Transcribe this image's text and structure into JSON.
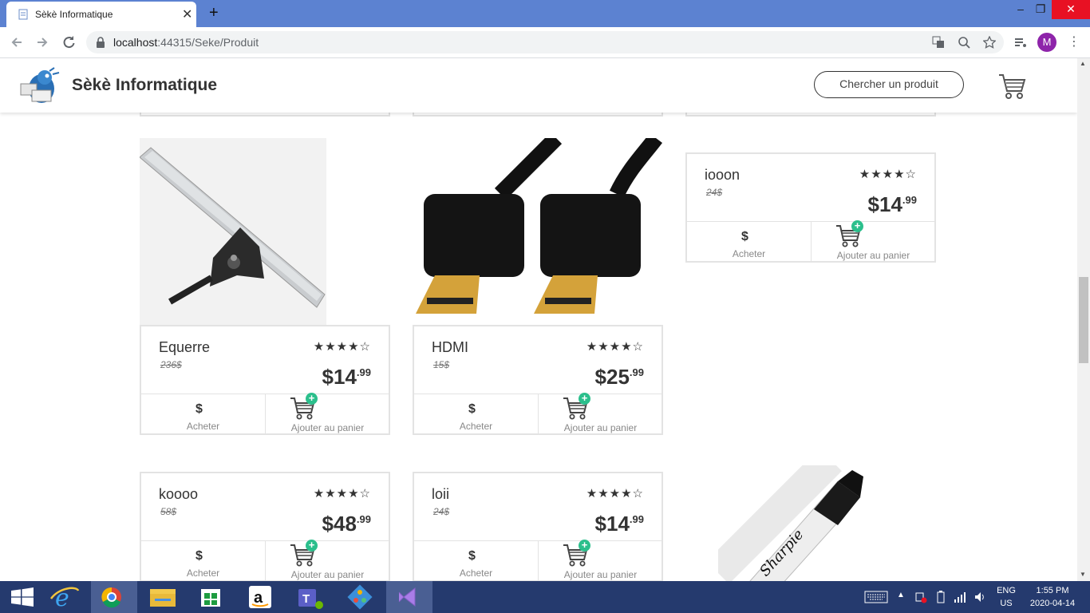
{
  "browser": {
    "tab_title": "Sèkè Informatique",
    "url_host": "localhost",
    "url_rest": ":44315/Seke/Produit",
    "profile_initial": "M"
  },
  "site": {
    "brand": "Sèkè Informatique",
    "search_label": "Chercher un produit"
  },
  "products": [
    {
      "name": "Equerre",
      "old_price": "236$",
      "price_main": "$14",
      "price_cents": ".99",
      "stars": "★★★★☆",
      "rating": 4,
      "buy_label": "Acheter",
      "cart_label": "Ajouter au panier"
    },
    {
      "name": "HDMI",
      "old_price": "15$",
      "price_main": "$25",
      "price_cents": ".99",
      "stars": "★★★★☆",
      "rating": 4,
      "buy_label": "Acheter",
      "cart_label": "Ajouter au panier"
    },
    {
      "name": "iooon",
      "old_price": "24$",
      "price_main": "$14",
      "price_cents": ".99",
      "stars": "★★★★☆",
      "rating": 4,
      "buy_label": "Acheter",
      "cart_label": "Ajouter au panier"
    },
    {
      "name": "koooo",
      "old_price": "58$",
      "price_main": "$48",
      "price_cents": ".99",
      "stars": "★★★★☆",
      "rating": 4,
      "buy_label": "Acheter",
      "cart_label": "Ajouter au panier"
    },
    {
      "name": "loii",
      "old_price": "24$",
      "price_main": "$14",
      "price_cents": ".99",
      "stars": "★★★★☆",
      "rating": 4,
      "buy_label": "Acheter",
      "cart_label": "Ajouter au panier"
    }
  ],
  "taskbar": {
    "lang_top": "ENG",
    "lang_bottom": "US",
    "time": "1:55 PM",
    "date": "2020-04-14"
  }
}
